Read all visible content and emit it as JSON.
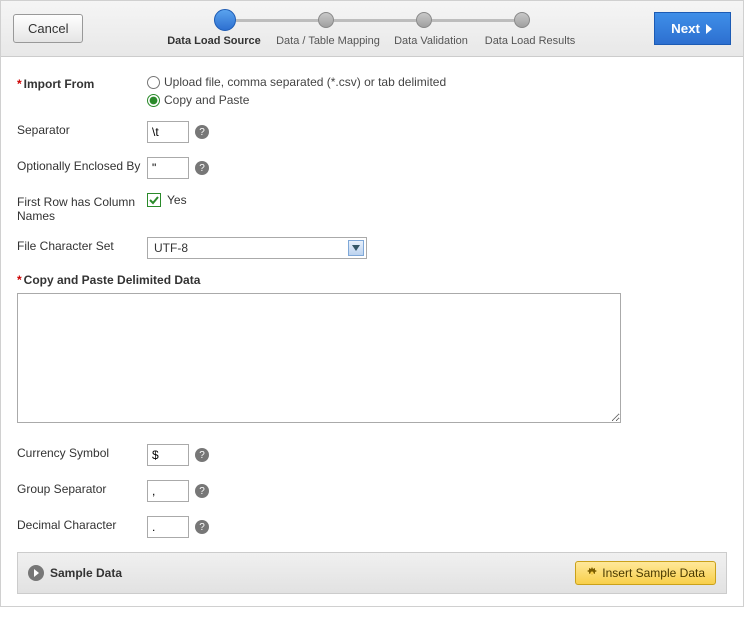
{
  "header": {
    "cancel": "Cancel",
    "next": "Next",
    "steps": [
      "Data Load Source",
      "Data / Table Mapping",
      "Data Validation",
      "Data Load Results"
    ]
  },
  "importFrom": {
    "label": "Import From",
    "opt1": "Upload file, comma separated (*.csv) or tab delimited",
    "opt2": "Copy and Paste"
  },
  "separator": {
    "label": "Separator",
    "value": "\\t"
  },
  "enclosed": {
    "label": "Optionally Enclosed By",
    "value": "\""
  },
  "firstRow": {
    "label": "First Row has Column Names",
    "yes": "Yes"
  },
  "charset": {
    "label": "File Character Set",
    "value": "UTF-8"
  },
  "copyPaste": {
    "label": "Copy and Paste Delimited Data"
  },
  "currency": {
    "label": "Currency Symbol",
    "value": "$"
  },
  "group": {
    "label": "Group Separator",
    "value": ","
  },
  "decimal": {
    "label": "Decimal Character",
    "value": "."
  },
  "sample": {
    "title": "Sample Data",
    "button": "Insert Sample Data"
  }
}
